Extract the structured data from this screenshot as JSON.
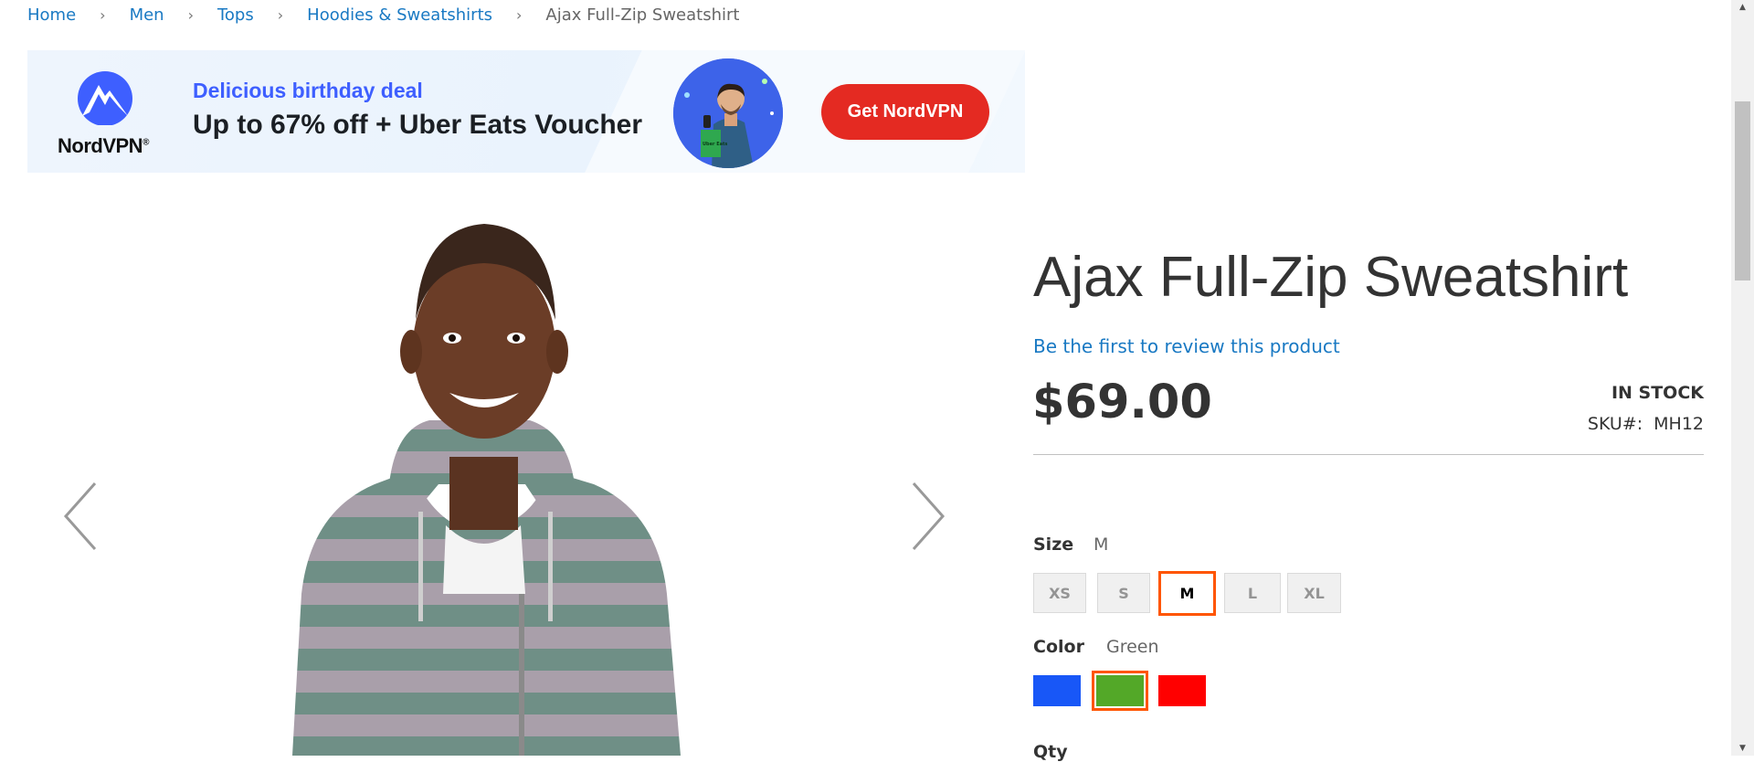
{
  "breadcrumb": {
    "items": [
      "Home",
      "Men",
      "Tops",
      "Hoodies & Sweatshirts"
    ],
    "current": "Ajax Full-Zip Sweatshirt",
    "separator": "›"
  },
  "ad": {
    "brand": "NordVPN",
    "headline_small": "Delicious birthday deal",
    "headline_main": "Up to 67% off + Uber Eats Voucher",
    "cta_label": "Get NordVPN",
    "bag_text": "Uber Eats"
  },
  "product": {
    "title": "Ajax Full-Zip Sweatshirt",
    "review_link": "Be the first to review this product",
    "price": "$69.00",
    "stock": "IN STOCK",
    "sku_label": "SKU#:",
    "sku_value": "MH12",
    "size": {
      "label": "Size",
      "selected": "M",
      "options": [
        "XS",
        "S",
        "M",
        "L",
        "XL"
      ]
    },
    "color": {
      "label": "Color",
      "selected": "Green",
      "swatches": [
        "blue",
        "green",
        "red"
      ],
      "colors": {
        "blue": "#1857f7",
        "green": "#53a828",
        "red": "#ff0000"
      }
    },
    "qty_label": "Qty"
  },
  "colors": {
    "link": "#1979c3",
    "selected_outline": "#ff5501",
    "cta": "#e42a22"
  }
}
